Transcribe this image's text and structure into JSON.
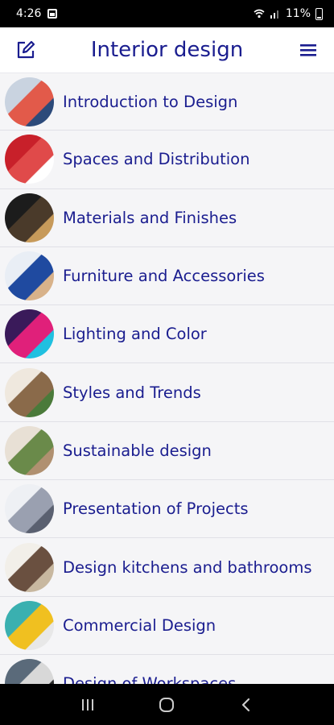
{
  "status": {
    "time": "4:26",
    "battery": "11%"
  },
  "app_bar": {
    "title": "Interior design",
    "edit_icon": "edit-icon",
    "menu_icon": "hamburger-menu-icon"
  },
  "colors": {
    "accent": "#1a1d8f",
    "row_bg": "#f5f5f7",
    "divider": "#e0e0e6"
  },
  "topics": [
    {
      "label": "Introduction to Design",
      "thumb": [
        "#c9d3e0",
        "#e25a4a",
        "#2c4a7a"
      ]
    },
    {
      "label": "Spaces and Distribution",
      "thumb": [
        "#c8202a",
        "#e04a4a",
        "#ffffff"
      ]
    },
    {
      "label": "Materials and Finishes",
      "thumb": [
        "#1c1c1c",
        "#4a3a2a",
        "#c79a5a"
      ]
    },
    {
      "label": "Furniture and Accessories",
      "thumb": [
        "#e9eef5",
        "#1f4aa0",
        "#d8b28a"
      ]
    },
    {
      "label": "Lighting and Color",
      "thumb": [
        "#3a1a5a",
        "#e0207a",
        "#20c0e0"
      ]
    },
    {
      "label": "Styles and Trends",
      "thumb": [
        "#efe8de",
        "#8a6a4a",
        "#4a7a3a"
      ]
    },
    {
      "label": "Sustainable design",
      "thumb": [
        "#e8e0d5",
        "#6a8a4a",
        "#b09070"
      ]
    },
    {
      "label": "Presentation of Projects",
      "thumb": [
        "#eef0f4",
        "#9aa0b0",
        "#5a6070"
      ]
    },
    {
      "label": "Design kitchens and bathrooms",
      "thumb": [
        "#f2efe9",
        "#6a5040",
        "#c8b8a0"
      ]
    },
    {
      "label": "Commercial Design",
      "thumb": [
        "#3ab0b0",
        "#f0c020",
        "#e8e8e8"
      ]
    },
    {
      "label": "Design of Workspaces",
      "thumb": [
        "#5a6a7a",
        "#d8d8d8",
        "#2a2a2a"
      ]
    }
  ]
}
